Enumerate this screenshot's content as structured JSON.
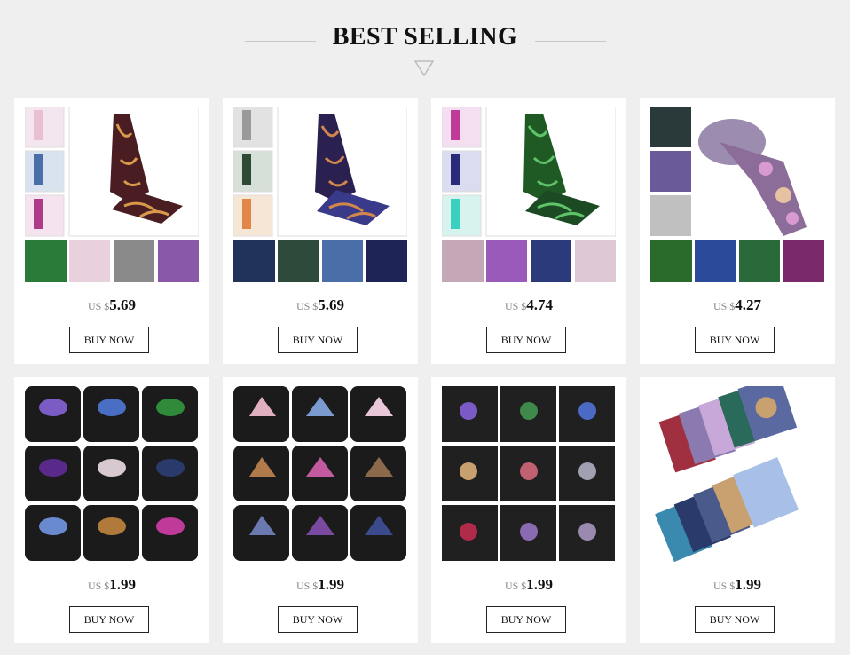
{
  "header": {
    "title": "BEST SELLING"
  },
  "products": [
    {
      "currency": "US $",
      "price": "5.69",
      "buy_label": "BUY NOW",
      "image": "paisley-tie-pocket-square-set-brown",
      "main_color": "#4a1d22",
      "accent_color": "#d89a4a"
    },
    {
      "currency": "US $",
      "price": "5.69",
      "buy_label": "BUY NOW",
      "image": "paisley-tie-pocket-square-set-navy",
      "main_color": "#2a2150",
      "accent_color": "#d4874a"
    },
    {
      "currency": "US $",
      "price": "4.74",
      "buy_label": "BUY NOW",
      "image": "paisley-tie-pocket-square-set-green",
      "main_color": "#1f5a24",
      "accent_color": "#5fc36a"
    },
    {
      "currency": "US $",
      "price": "4.27",
      "buy_label": "BUY NOW",
      "image": "floral-tie-collection",
      "main_color": "#8c6d9a",
      "accent_color": "#d99ad0"
    },
    {
      "currency": "US $",
      "price": "1.99",
      "buy_label": "BUY NOW",
      "image": "pocket-squares-in-suit-grid",
      "main_color": "#1b1b1b",
      "accent_color": "#7b5bc4"
    },
    {
      "currency": "US $",
      "price": "1.99",
      "buy_label": "BUY NOW",
      "image": "pocket-squares-in-suit-grid",
      "main_color": "#1b1b1b",
      "accent_color": "#c25aa0"
    },
    {
      "currency": "US $",
      "price": "1.99",
      "buy_label": "BUY NOW",
      "image": "pocket-squares-in-suit-grid",
      "main_color": "#202020",
      "accent_color": "#3f8a4a"
    },
    {
      "currency": "US $",
      "price": "1.99",
      "buy_label": "BUY NOW",
      "image": "fanned-pocket-squares",
      "main_color": "#5a6aa0",
      "accent_color": "#c9a070"
    }
  ]
}
